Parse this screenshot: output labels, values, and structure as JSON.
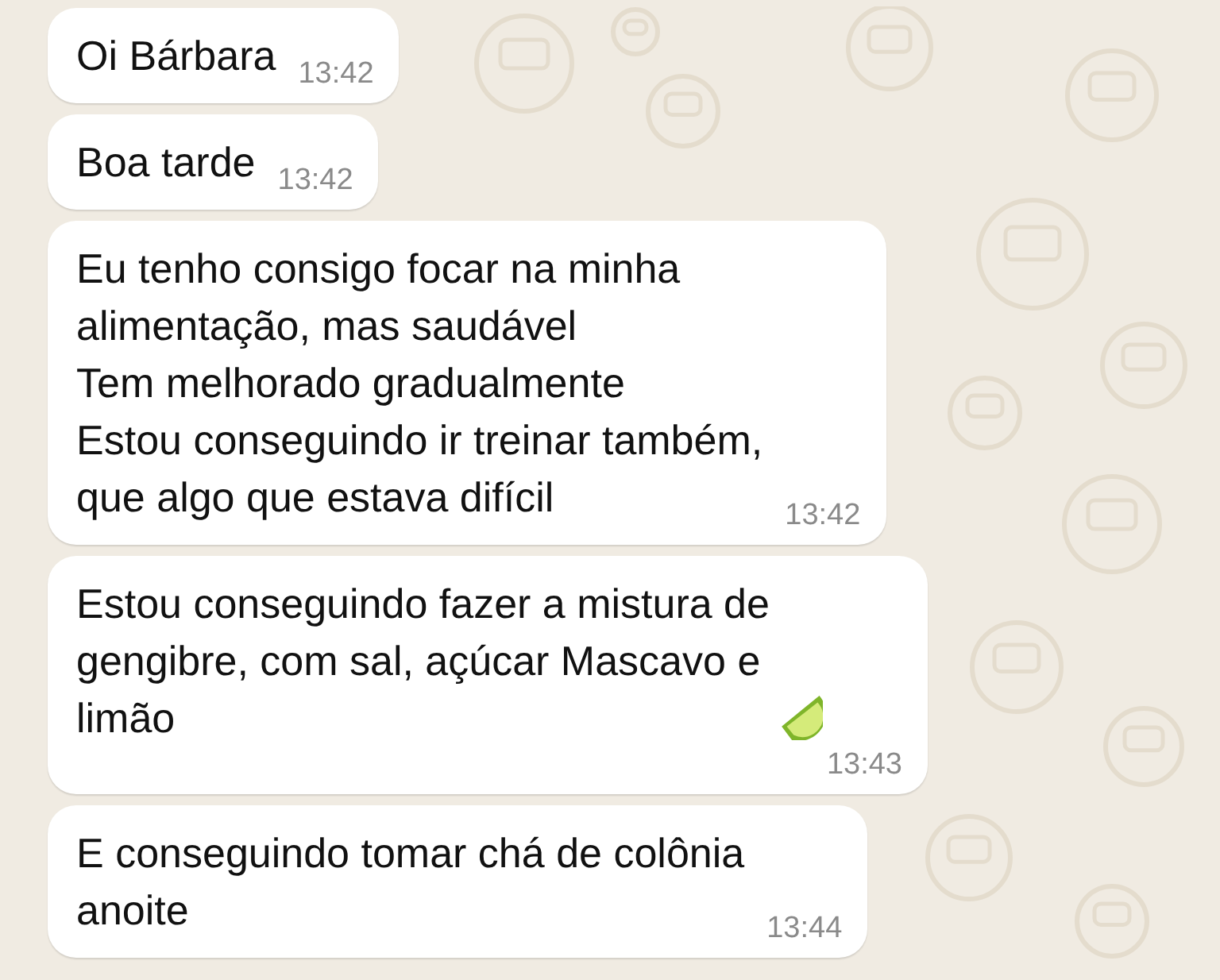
{
  "messages": [
    {
      "text": "Oi Bárbara",
      "time": "13:42",
      "emoji": false
    },
    {
      "text": "Boa tarde",
      "time": "13:42",
      "emoji": false
    },
    {
      "text": "Eu tenho consigo focar na minha\nalimentação, mas saudável\nTem melhorado gradualmente\nEstou conseguindo ir treinar também,\nque algo que estava difícil",
      "time": "13:42",
      "emoji": false
    },
    {
      "text": "Estou conseguindo fazer a mistura de\ngengibre, com sal, açúcar Mascavo e\nlimão",
      "time": "13:43",
      "emoji": true
    },
    {
      "text": "E conseguindo tomar chá de colônia\nanoite",
      "time": "13:44",
      "emoji": false
    }
  ]
}
